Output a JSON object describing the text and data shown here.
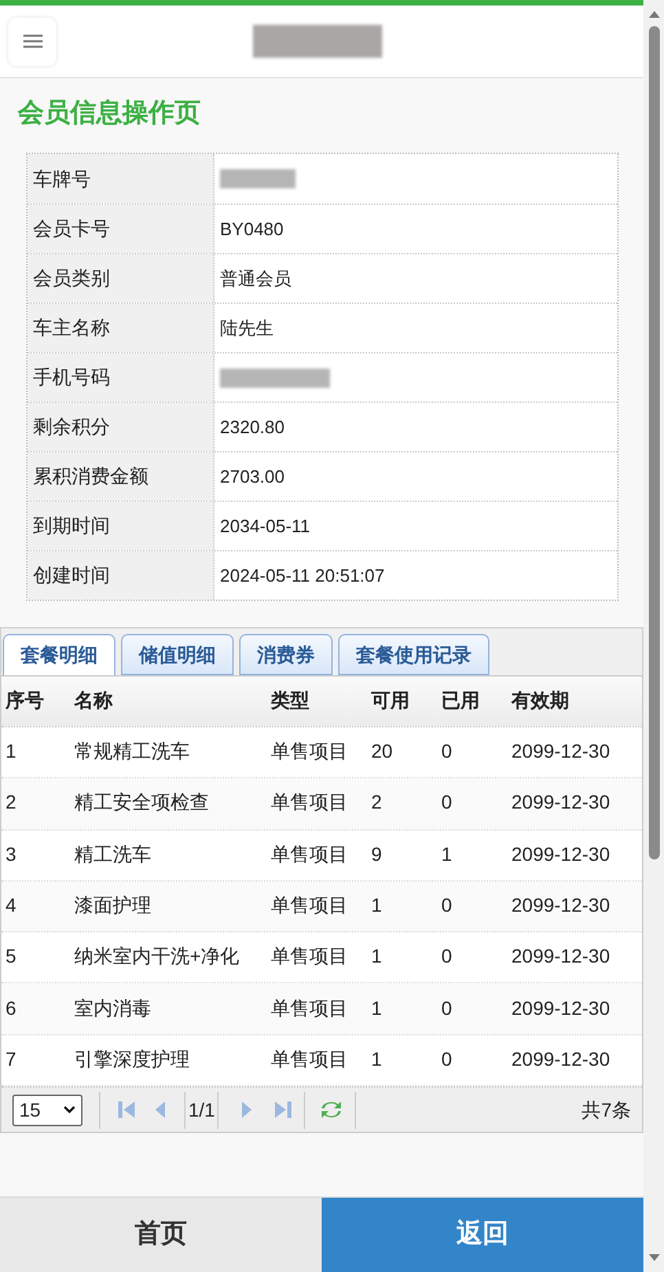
{
  "page_title": "会员信息操作页",
  "info": [
    {
      "label": "车牌号"
    },
    {
      "label": "会员卡号",
      "value": "BY0480"
    },
    {
      "label": "会员类别",
      "value": "普通会员"
    },
    {
      "label": "车主名称",
      "value": "陆先生"
    },
    {
      "label": "手机号码"
    },
    {
      "label": "剩余积分",
      "value": "2320.80"
    },
    {
      "label": "累积消费金额",
      "value": "2703.00"
    },
    {
      "label": "到期时间",
      "value": "2034-05-11"
    },
    {
      "label": "创建时间",
      "value": "2024-05-11 20:51:07"
    }
  ],
  "tabs": [
    {
      "label": "套餐明细",
      "selected": true
    },
    {
      "label": "储值明细",
      "selected": false
    },
    {
      "label": "消费券",
      "selected": false
    },
    {
      "label": "套餐使用记录",
      "selected": false
    }
  ],
  "table": {
    "columns": [
      "序号",
      "名称",
      "类型",
      "可用",
      "已用",
      "有效期"
    ],
    "rows": [
      [
        "1",
        "常规精工洗车",
        "单售项目",
        "20",
        "0",
        "2099-12-30"
      ],
      [
        "2",
        "精工安全项检查",
        "单售项目",
        "2",
        "0",
        "2099-12-30"
      ],
      [
        "3",
        "精工洗车",
        "单售项目",
        "9",
        "1",
        "2099-12-30"
      ],
      [
        "4",
        "漆面护理",
        "单售项目",
        "1",
        "0",
        "2099-12-30"
      ],
      [
        "5",
        "纳米室内干洗+净化",
        "单售项目",
        "1",
        "0",
        "2099-12-30"
      ],
      [
        "6",
        "室内消毒",
        "单售项目",
        "1",
        "0",
        "2099-12-30"
      ],
      [
        "7",
        "引擎深度护理",
        "单售项目",
        "1",
        "0",
        "2099-12-30"
      ]
    ]
  },
  "pager": {
    "page_size": "15",
    "page": "1/1",
    "total": "共7条"
  },
  "footer": {
    "home": "首页",
    "back": "返回"
  }
}
